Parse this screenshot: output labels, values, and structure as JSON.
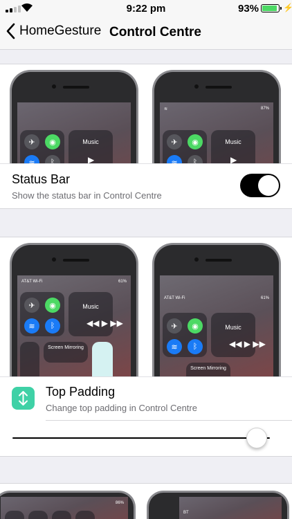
{
  "status_bar": {
    "time": "9:22 pm",
    "battery_percent": "93%",
    "battery_level": 0.93,
    "signal_bars": 2,
    "icons": [
      "signal-icon",
      "wifi-icon",
      "battery-icon",
      "charging-bolt-icon"
    ]
  },
  "nav": {
    "back_label": "HomeGesture",
    "title": "Control Centre",
    "back_icon": "chevron-left-icon"
  },
  "sections": [
    {
      "title": "Status Bar",
      "subtitle": "Show the status bar in Control Centre",
      "toggle_on": true,
      "previews": [
        {
          "status_text": "",
          "music_label": "Music"
        },
        {
          "status_text": "87%",
          "music_label": "Music"
        }
      ]
    },
    {
      "title": "Top Padding",
      "subtitle": "Change top padding in Control Centre",
      "icon": "vertical-arrows-icon",
      "slider_value": 0.95,
      "previews": [
        {
          "carrier": "AT&T Wi-Fi",
          "battery": "61%",
          "music_label": "Music",
          "mirror_label": "Screen Mirroring"
        },
        {
          "carrier": "AT&T Wi-Fi",
          "battery": "61%",
          "music_label": "Music",
          "mirror_label": "Screen Mirroring"
        }
      ]
    },
    {
      "previews": [
        {
          "battery": "86%"
        },
        {
          "carrier": "BT"
        }
      ]
    }
  ],
  "colors": {
    "toggle_on": "#000000",
    "accent_green": "#4cd964",
    "accent_blue": "#1a7bf6",
    "padding_icon": "#3fd1a6"
  }
}
